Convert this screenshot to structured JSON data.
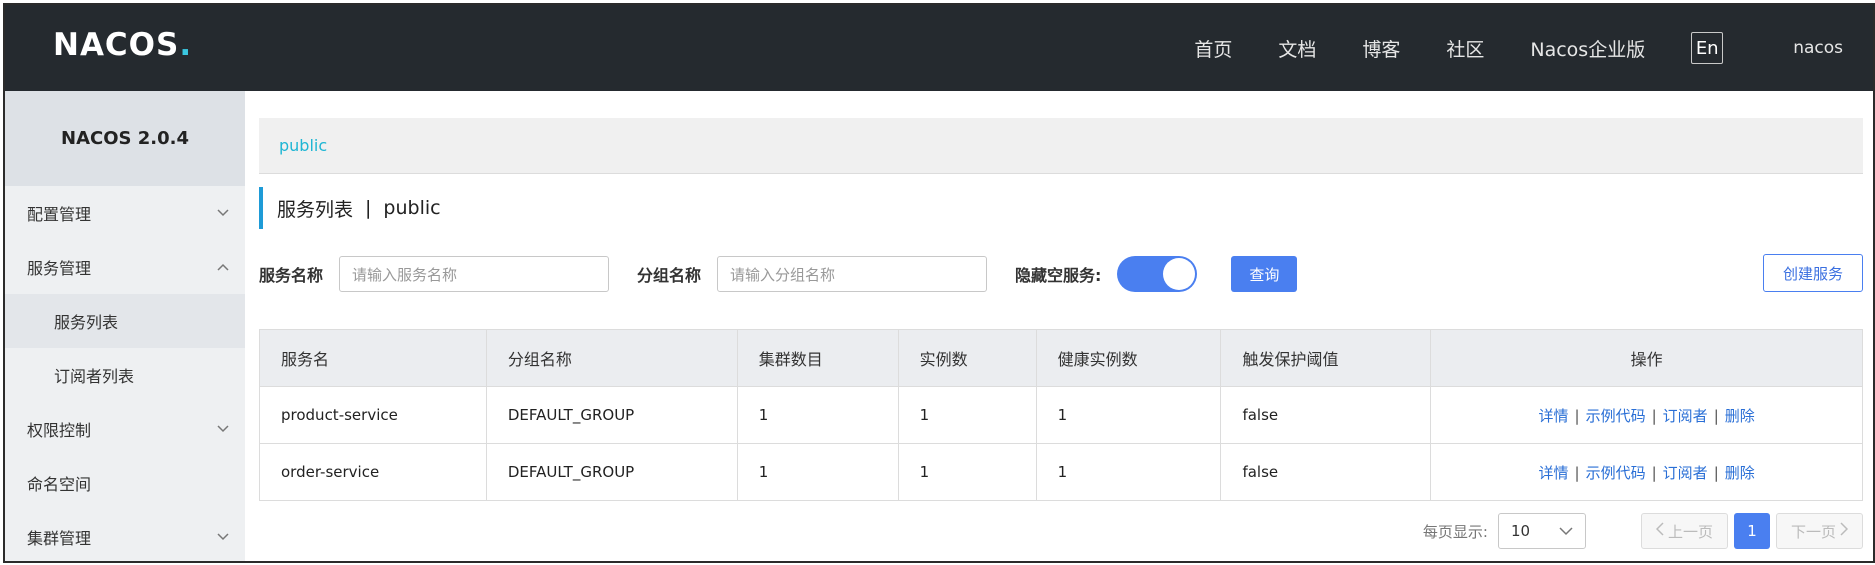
{
  "header": {
    "logo": "NACOS",
    "logo_dot": ".",
    "nav": [
      "首页",
      "文档",
      "博客",
      "社区",
      "Nacos企业版"
    ],
    "lang": "En",
    "user": "nacos"
  },
  "sidebar": {
    "version": "NACOS 2.0.4",
    "items": [
      {
        "label": "配置管理",
        "icon": "chevron-down-icon"
      },
      {
        "label": "服务管理",
        "icon": "chevron-up-icon"
      },
      {
        "label": "服务列表"
      },
      {
        "label": "订阅者列表"
      },
      {
        "label": "权限控制",
        "icon": "chevron-down-icon"
      },
      {
        "label": "命名空间"
      },
      {
        "label": "集群管理",
        "icon": "chevron-down-icon"
      }
    ]
  },
  "namespace": {
    "current": "public"
  },
  "page": {
    "title": "服务列表",
    "sep": "|",
    "namespace": "public"
  },
  "filters": {
    "service_label": "服务名称",
    "service_placeholder": "请输入服务名称",
    "group_label": "分组名称",
    "group_placeholder": "请输入分组名称",
    "hide_empty_label": "隐藏空服务:",
    "hide_empty_on": true,
    "query_label": "查询",
    "create_label": "创建服务"
  },
  "table": {
    "headers": [
      "服务名",
      "分组名称",
      "集群数目",
      "实例数",
      "健康实例数",
      "触发保护阈值",
      "操作"
    ],
    "rows": [
      [
        "product-service",
        "DEFAULT_GROUP",
        "1",
        "1",
        "1",
        "false"
      ],
      [
        "order-service",
        "DEFAULT_GROUP",
        "1",
        "1",
        "1",
        "false"
      ]
    ],
    "actions": [
      "详情",
      "示例代码",
      "订阅者",
      "删除"
    ]
  },
  "pagination": {
    "per_page_label": "每页显示:",
    "per_page": "10",
    "prev": "上一页",
    "next": "下一页",
    "current": "1"
  },
  "colors": {
    "accent": "#4a7ff0",
    "link": "#2a6fd6",
    "nav_bg": "#252a2f",
    "ns_link": "#1fb6d4"
  }
}
